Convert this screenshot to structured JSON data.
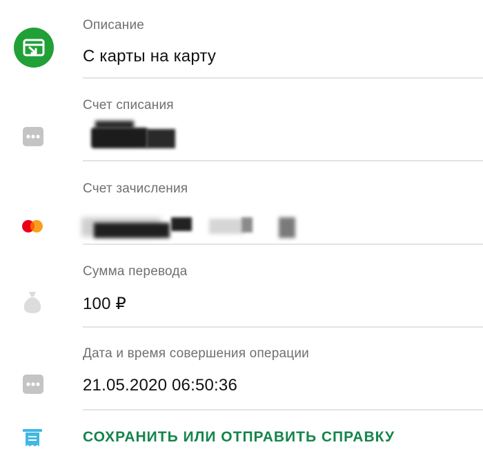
{
  "operation": {
    "description": {
      "label": "Описание",
      "value": "С карты на карту"
    },
    "debit_account": {
      "label": "Счет списания",
      "value": ""
    },
    "credit_account": {
      "label": "Счет зачисления",
      "value": ""
    },
    "amount": {
      "label": "Сумма перевода",
      "value": "100 ₽"
    },
    "datetime": {
      "label": "Дата и время совершения операции",
      "value": "21.05.2020 06:50:36"
    }
  },
  "actions": {
    "save_label": "СОХРАНИТЬ ИЛИ ОТПРАВИТЬ СПРАВКУ"
  },
  "colors": {
    "brand_green": "#21a038",
    "action_green": "#14854a",
    "icon_gray": "#c4c4c4",
    "receipt_blue": "#3fb8e6"
  },
  "icons": [
    "card-transfer-icon",
    "more-icon",
    "mastercard-icon",
    "money-bag-icon",
    "more-icon",
    "receipt-icon"
  ]
}
